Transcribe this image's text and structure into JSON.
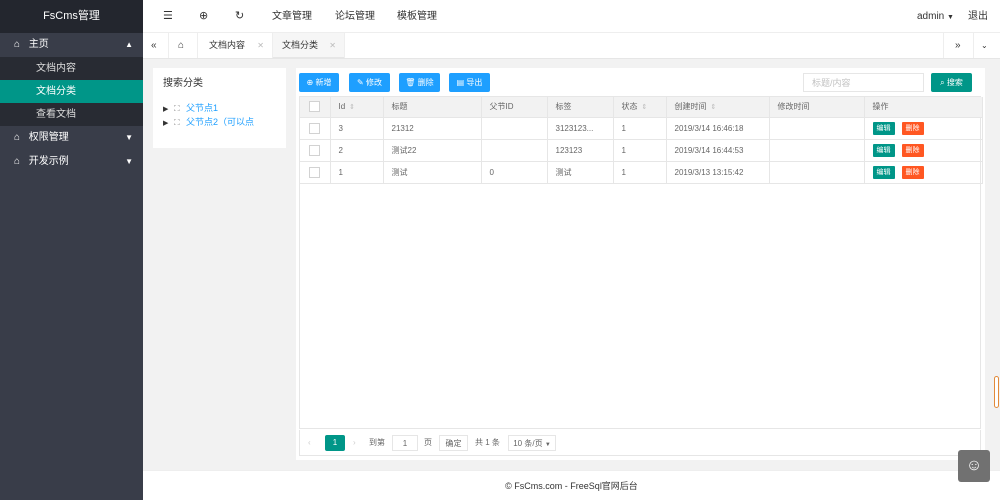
{
  "app": {
    "title": "FsCms管理"
  },
  "sidebar": {
    "items": [
      {
        "label": "主页",
        "expanded": true,
        "children": [
          {
            "label": "文档内容"
          },
          {
            "label": "文档分类",
            "active": true
          },
          {
            "label": "查看文档"
          }
        ]
      },
      {
        "label": "权限管理"
      },
      {
        "label": "开发示例"
      }
    ]
  },
  "header": {
    "menus": [
      "文章管理",
      "论坛管理",
      "模板管理"
    ],
    "user": "admin",
    "logout": "退出"
  },
  "tabs": [
    {
      "label": "文档内容"
    },
    {
      "label": "文档分类",
      "active": true
    }
  ],
  "category": {
    "title": "搜索分类",
    "nodes": [
      "父节点1",
      "父节点2（可以点"
    ]
  },
  "toolbar": {
    "add": "新增",
    "edit": "修改",
    "delete": "删除",
    "export": "导出",
    "search_placeholder": "标题/内容",
    "search": "搜索"
  },
  "table": {
    "columns": [
      "Id",
      "标题",
      "父节ID",
      "标签",
      "状态",
      "创建时间",
      "修改时间",
      "操作"
    ],
    "rows": [
      {
        "id": "3",
        "title": "21312",
        "parent": "",
        "tag": "3123123...",
        "status": "1",
        "created": "2019/3/14 16:46:18",
        "modified": ""
      },
      {
        "id": "2",
        "title": "测试22",
        "parent": "",
        "tag": "123123",
        "status": "1",
        "created": "2019/3/14 16:44:53",
        "modified": ""
      },
      {
        "id": "1",
        "title": "测试",
        "parent": "0",
        "tag": "测试",
        "status": "1",
        "created": "2019/3/13 13:15:42",
        "modified": ""
      }
    ],
    "row_actions": {
      "edit": "编辑",
      "delete": "删除"
    }
  },
  "pager": {
    "current": "1",
    "goto": "到第",
    "page_input": "1",
    "page_unit": "页",
    "confirm": "确定",
    "total": "共 1 条",
    "page_size": "10 条/页"
  },
  "footer": {
    "text": "© FsCms.com - FreeSql官网后台"
  },
  "colors": {
    "sidebar": "#393d49",
    "accent": "#009688",
    "blue": "#1e9fff",
    "danger": "#ff5722"
  }
}
